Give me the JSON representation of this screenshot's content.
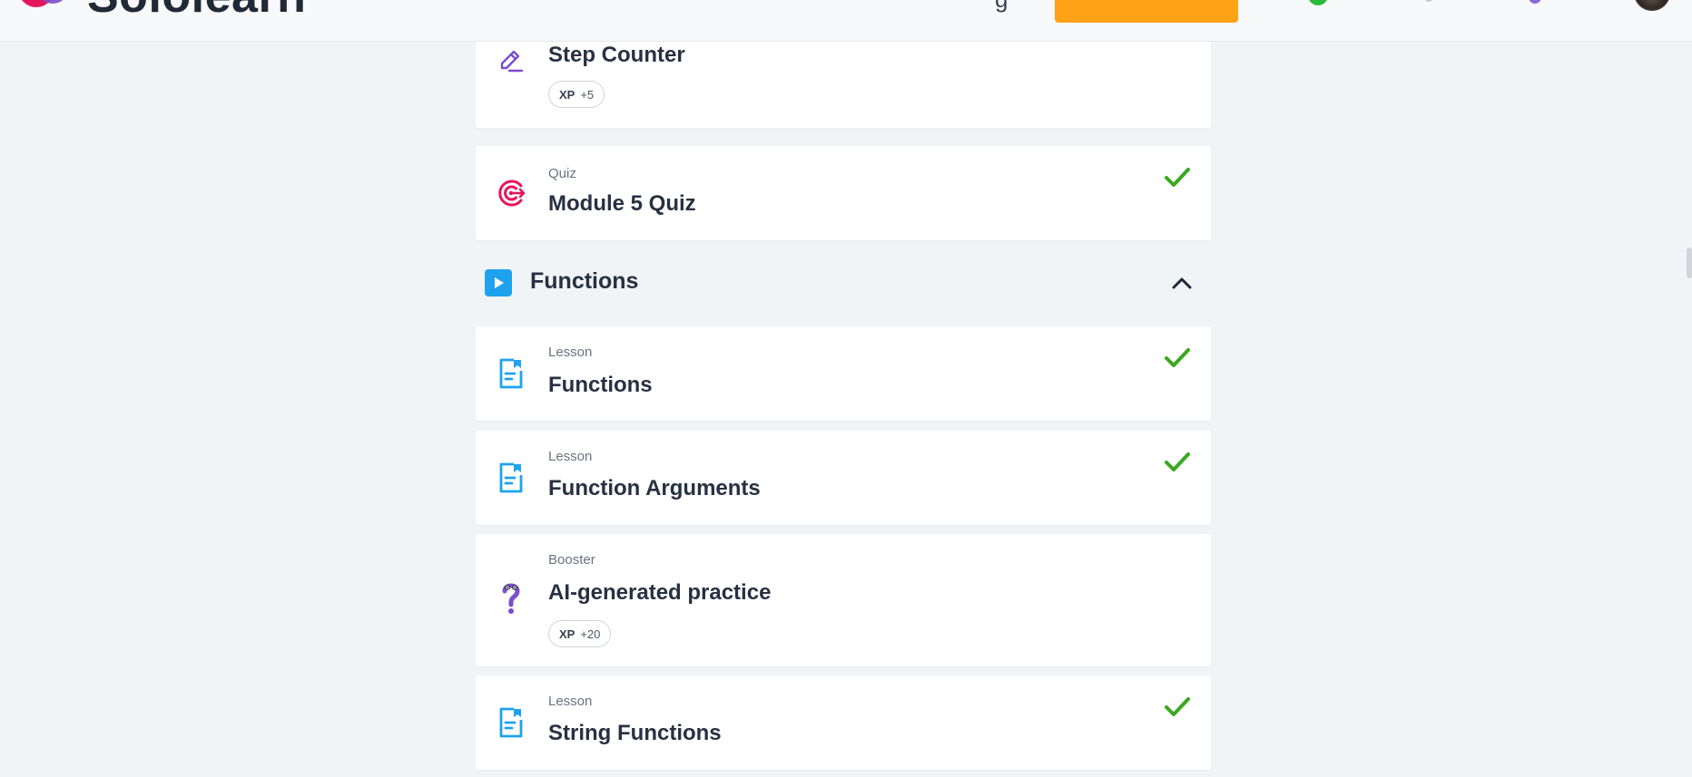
{
  "header": {
    "brand": "Sololearn",
    "nav_fragment": "g"
  },
  "section": {
    "title": "Functions"
  },
  "cards": {
    "step_counter": {
      "title": "Step Counter",
      "xp_label": "XP",
      "xp_value": "+5"
    },
    "module_quiz": {
      "kind": "Quiz",
      "title": "Module 5 Quiz"
    },
    "functions": {
      "kind": "Lesson",
      "title": "Functions"
    },
    "function_arguments": {
      "kind": "Lesson",
      "title": "Function Arguments"
    },
    "ai_practice": {
      "kind": "Booster",
      "title": "AI-generated practice",
      "xp_label": "XP",
      "xp_value": "+20"
    },
    "string_functions": {
      "kind": "Lesson",
      "title": "String Functions"
    }
  },
  "colors": {
    "page_bg": "#f1f4f7",
    "card_bg": "#ffffff",
    "check_green": "#3aa81f",
    "lesson_blue": "#1fa2ee",
    "quiz_pink": "#e3165b",
    "practice_purple": "#7c4dcc",
    "cta_orange": "#ffa218"
  },
  "icons": {
    "step_counter": "pencil-icon",
    "module_quiz": "target-icon",
    "section": "play-icon",
    "collapse": "chevron-up-icon",
    "lesson": "document-icon",
    "booster": "question-mark-icon",
    "completed": "checkmark-icon"
  }
}
